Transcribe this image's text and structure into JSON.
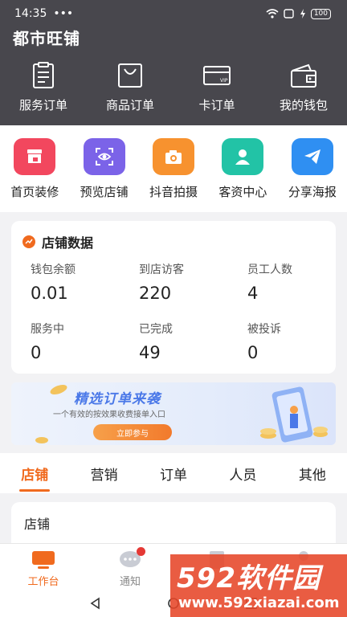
{
  "status": {
    "time": "14:35",
    "battery": "100"
  },
  "app_title": "都市旺铺",
  "quick_actions": [
    {
      "label": "服务订单",
      "icon": "clipboard-icon"
    },
    {
      "label": "商品订单",
      "icon": "shopping-bag-icon"
    },
    {
      "label": "卡订单",
      "icon": "vip-card-icon"
    },
    {
      "label": "我的钱包",
      "icon": "wallet-icon"
    }
  ],
  "features": [
    {
      "label": "首页装修",
      "icon": "storefront-icon",
      "color": "#f2475e"
    },
    {
      "label": "预览店铺",
      "icon": "eye-scan-icon",
      "color": "#7b63e8"
    },
    {
      "label": "抖音拍摄",
      "icon": "camera-icon",
      "color": "#f7922f"
    },
    {
      "label": "客资中心",
      "icon": "user-icon",
      "color": "#22c3a6"
    },
    {
      "label": "分享海报",
      "icon": "send-icon",
      "color": "#2f8ff2"
    }
  ],
  "store_data": {
    "title": "店铺数据",
    "stats": [
      {
        "label": "钱包余额",
        "value": "0.01"
      },
      {
        "label": "到店访客",
        "value": "220"
      },
      {
        "label": "员工人数",
        "value": "4"
      },
      {
        "label": "服务中",
        "value": "0"
      },
      {
        "label": "已完成",
        "value": "49"
      },
      {
        "label": "被投诉",
        "value": "0"
      }
    ]
  },
  "banner": {
    "title": "精选订单来袭",
    "subtitle": "一个有效的按效果收费接单入口",
    "button": "立即参与"
  },
  "tabs": [
    "店铺",
    "营销",
    "订单",
    "人员",
    "其他"
  ],
  "section_title": "店铺",
  "bottom_nav": [
    {
      "label": "工作台",
      "icon": "workbench-icon"
    },
    {
      "label": "通知",
      "icon": "chat-bubble-icon"
    },
    {
      "label": "",
      "icon": "list-icon"
    },
    {
      "label": "",
      "icon": "profile-icon"
    }
  ],
  "watermark": {
    "brand": "592软件园",
    "url": "www.592xiazai.com"
  },
  "colors": {
    "accent": "#f06a1e",
    "header": "#48474d"
  }
}
